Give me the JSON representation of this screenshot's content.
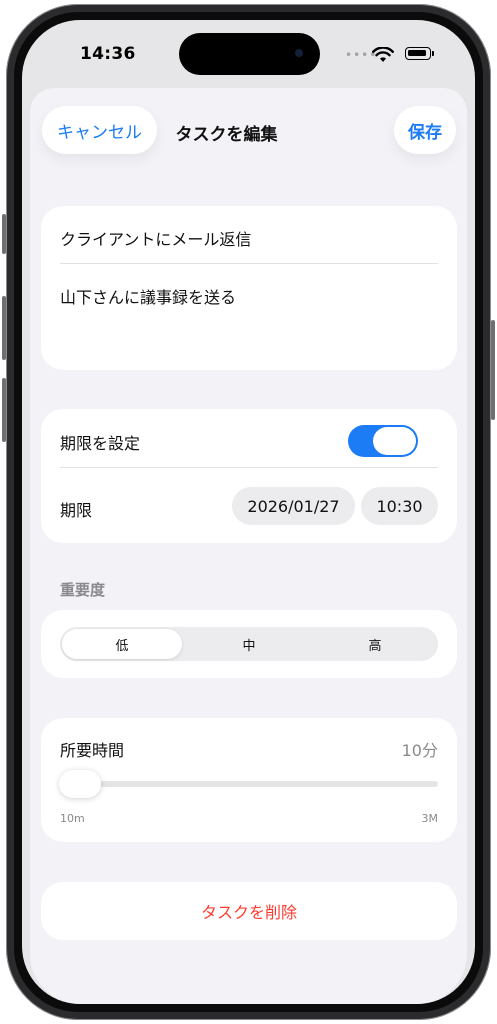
{
  "status": {
    "time": "14:36"
  },
  "nav": {
    "cancel": "キャンセル",
    "title": "タスクを編集",
    "save": "保存"
  },
  "task": {
    "title": "クライアントにメール返信",
    "notes": "山下さんに議事録を送る"
  },
  "deadline": {
    "toggle_label": "期限を設定",
    "toggle_on": true,
    "label": "期限",
    "date": "2026/01/27",
    "time": "10:30"
  },
  "priority": {
    "section_label": "重要度",
    "options": [
      "低",
      "中",
      "高"
    ],
    "selected": "低"
  },
  "duration": {
    "label": "所要時間",
    "value": "10分",
    "min_label": "10m",
    "max_label": "3M",
    "slider_fraction": 0.0
  },
  "actions": {
    "delete": "タスクを削除"
  },
  "colors": {
    "accent": "#1b7cf5",
    "destructive": "#ff3b30",
    "background": "#f2f2f7",
    "card": "#ffffff"
  }
}
